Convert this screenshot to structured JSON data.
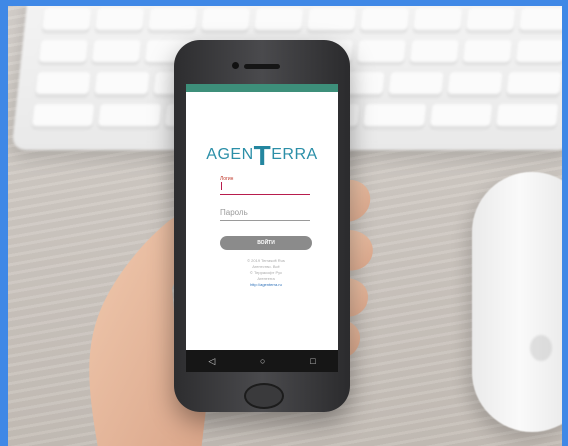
{
  "app": {
    "logo_left": "AGEN",
    "logo_t": "T",
    "logo_right": "ERRA",
    "login_label": "Логин",
    "password_placeholder": "Пароль",
    "login_button": "ВОЙТИ",
    "copyright_lines": [
      "© 2019 Terrasoft Rus",
      "Агентство. Всё",
      "© Терраcофт Рус",
      "Агентеrra",
      "http://agenterra.ru"
    ]
  },
  "android_nav": {
    "back_icon": "back-triangle-icon",
    "home_icon": "home-circle-icon",
    "recent_icon": "recent-square-icon"
  },
  "colors": {
    "accent": "#2b8fa8",
    "button": "#8b8b8b",
    "statusbar": "#3d8f7a",
    "input_underline": "#b81d4d"
  }
}
